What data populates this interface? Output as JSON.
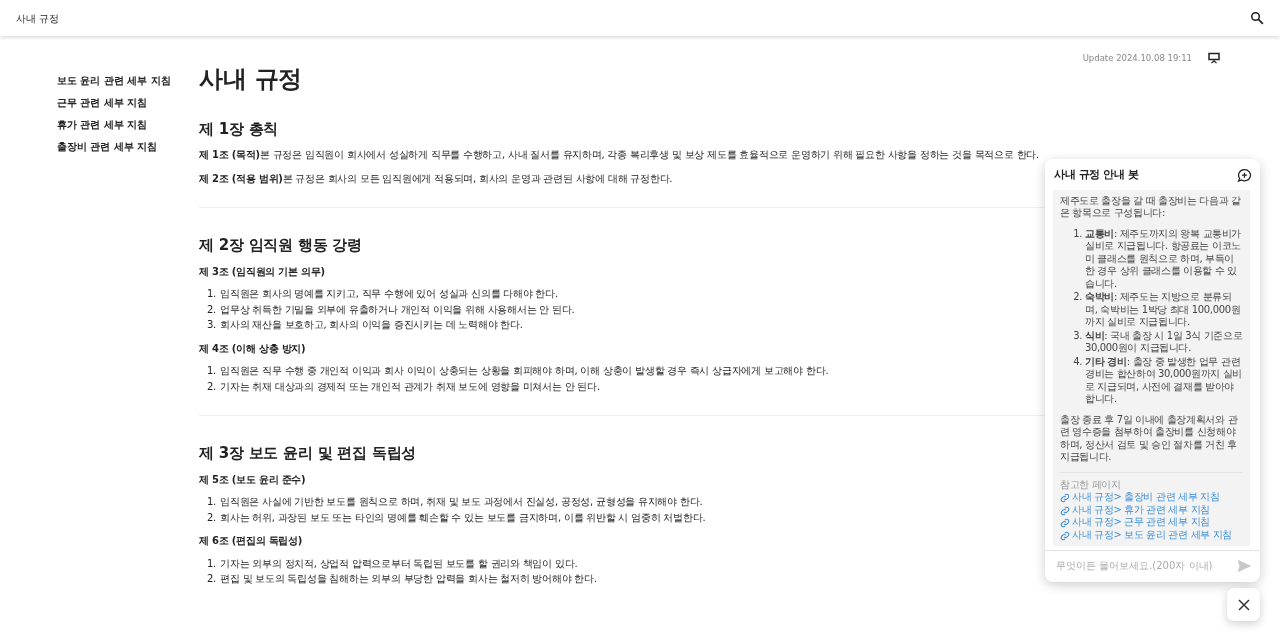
{
  "navbar": {
    "title": "사내 규정"
  },
  "update": "Update 2024.10.08 19:11",
  "toc": [
    {
      "label": "보도 윤리 관련 세부 지침"
    },
    {
      "label": "근무 관련 세부 지침"
    },
    {
      "label": "휴가 관련 세부 지침"
    },
    {
      "label": "출장비 관련 세부 지침"
    }
  ],
  "page_title": "사내 규정",
  "chapters": [
    {
      "title": "제 1장 총칙",
      "articles": [
        {
          "kind": "paragraph",
          "text": "**제 1조 (목적)**본 규정은 임직원이 회사에서 성실하게 직무를 수행하고, 사내 질서를 유지하며, 각종 복리후생 및 보상 제도를 효율적으로 운영하기 위해 필요한 사항을 정하는 것을 목적으로 한다."
        },
        {
          "kind": "paragraph",
          "text": "**제 2조 (적용 범위)**본 규정은 회사의 모든 임직원에게 적용되며, 회사의 운영과 관련된 사항에 대해 규정한다."
        }
      ]
    },
    {
      "title": "제 2장 임직원 행동 강령",
      "articles": [
        {
          "kind": "list",
          "heading": "제 3조 (임직원의 기본 의무)",
          "items": [
            {
              "number": "1.",
              "text": "임직원은 회사의 명예를 지키고, 직무 수행에 있어 성실과 신의를 다해야 한다."
            },
            {
              "number": "2.",
              "text": "업무상 취득한 기밀을 외부에 유출하거나 개인적 이익을 위해 사용해서는 안 된다."
            },
            {
              "number": "3.",
              "text": "회사의 재산을 보호하고, 회사의 이익을 증진시키는 데 노력해야 한다."
            }
          ]
        },
        {
          "kind": "list",
          "heading": "제 4조 (이해 상충 방지)",
          "items": [
            {
              "number": "1.",
              "text": "임직원은 직무 수행 중 개인적 이익과 회사 이익이 상충되는 상황을 회피해야 하며, 이해 상충이 발생할 경우 즉시 상급자에게 보고해야 한다."
            },
            {
              "number": "2.",
              "text": "기자는 취재 대상과의 경제적 또는 개인적 관계가 취재 보도에 영향을 미쳐서는 안 된다."
            }
          ]
        }
      ]
    },
    {
      "title": "제 3장 보도 윤리 및 편집 독립성",
      "articles": [
        {
          "kind": "list",
          "heading": "제 5조 (보도 윤리 준수)",
          "items": [
            {
              "number": "1.",
              "text": "임직원은 사실에 기반한 보도를 원칙으로 하며, 취재 및 보도 과정에서 진실성, 공정성, 균형성을 유지해야 한다."
            },
            {
              "number": "2.",
              "text": "회사는 허위, 과장된 보도 또는 타인의 명예를 훼손할 수 있는 보도를 금지하며, 이를 위반할 시 엄중히 처벌한다."
            }
          ]
        },
        {
          "kind": "list",
          "heading": "제 6조 (편집의 독립성)",
          "items": [
            {
              "number": "1.",
              "text": "기자는 외부의 정치적, 상업적 압력으로부터 독립된 보도를 할 권리와 책임이 있다."
            },
            {
              "number": "2.",
              "text": "편집 및 보도의 독립성을 침해하는 외부의 부당한 압력을 회사는 철저히 방어해야 한다."
            }
          ]
        }
      ]
    }
  ],
  "chat": {
    "title": "사내 규정 안내 봇",
    "message": {
      "intro": "제주도로 출장을 갈 때 출장비는 다음과 같은 항목으로 구성됩니다:",
      "items": [
        {
          "number": "1.",
          "text": "**교통비**: 제주도까지의 왕복 교통비가 실비로 지급됩니다. 항공료는 이코노미 클래스를 원칙으로 하며, 부득이한 경우 상위 클래스를 이용할 수 있습니다."
        },
        {
          "number": "2.",
          "text": "**숙박비**: 제주도는 지방으로 분류되며, 숙박비는 1박당 최대 100,000원까지 실비로 지급됩니다."
        },
        {
          "number": "3.",
          "text": "**식비**: 국내 출장 시 1일 3식 기준으로 30,000원이 지급됩니다."
        },
        {
          "number": "4.",
          "text": "**기타 경비**: 출장 중 발생한 업무 관련 경비는 합산하여 30,000원까지 실비로 지급되며, 사전에 결재를 받아야 합니다."
        }
      ],
      "outro": "출장 종료 후 7일 이내에 출장계획서와 관련 영수증을 첨부하여 출장비를 신청해야 하며, 정산서 검토 및 승인 절차를 거친 후 지급됩니다.",
      "references_label": "참고한 페이지",
      "references": [
        {
          "label": "사내 규정> 출장비 관련 세부 지침"
        },
        {
          "label": "사내 규정> 휴가 관련 세부 지침"
        },
        {
          "label": "사내 규정> 근무 관련 세부 지침"
        },
        {
          "label": "사내 규정> 보도 윤리 관련 세부 지침"
        }
      ]
    },
    "input": {
      "placeholder": "무엇이든 물어보세요.(200자 이내)"
    }
  }
}
